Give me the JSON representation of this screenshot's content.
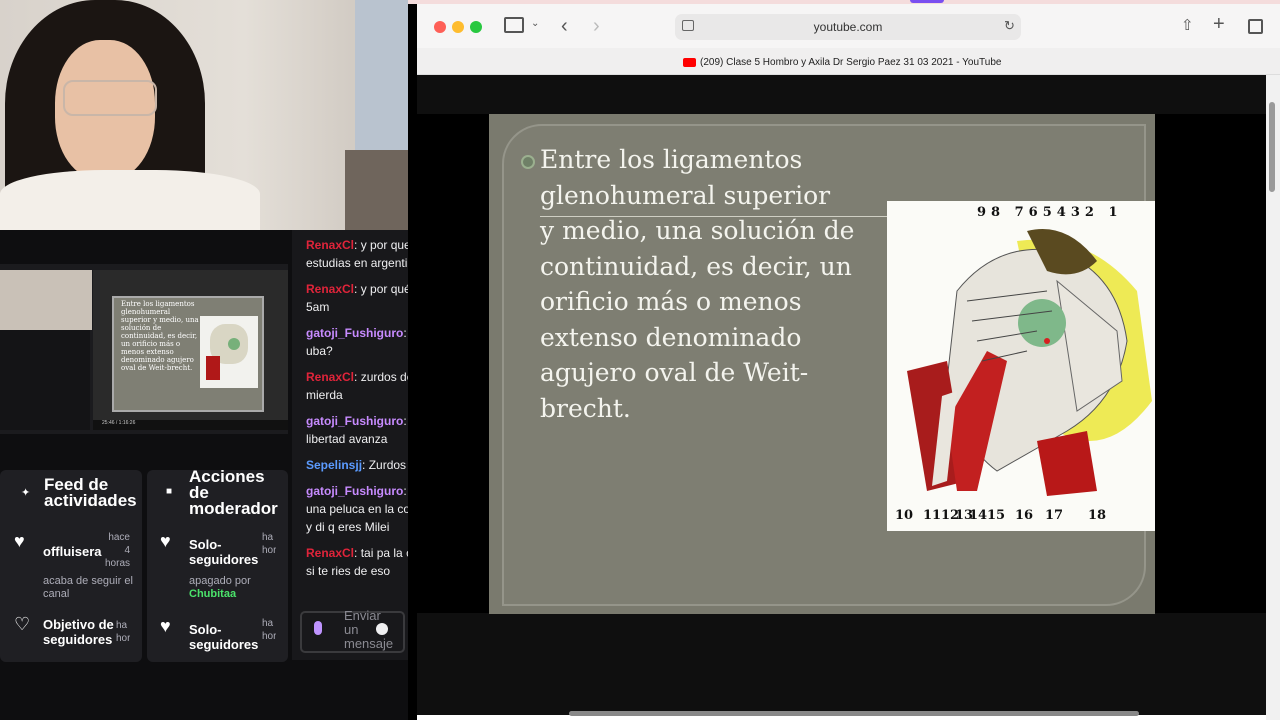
{
  "browser": {
    "url": "youtube.com",
    "tab_title": "(209) Clase 5 Hombro y Axila Dr Sergio Paez 31 03 2021 - YouTube"
  },
  "slide": {
    "lines": [
      "Entre los ligamentos",
      "glenohumeral superior",
      "y medio, una solución de",
      "continuidad, es decir, un",
      "orificio más o menos",
      "extenso denominado",
      "agujero oval de Weit-",
      "brecht."
    ],
    "top_numbers": [
      "9",
      "8",
      "7",
      "6",
      "5",
      "4",
      "3",
      "2",
      "1"
    ],
    "bottom_numbers": [
      "10",
      "11",
      "12",
      "13",
      "14",
      "15",
      "16",
      "17",
      "18"
    ]
  },
  "preview": {
    "slide_text": "Entre los ligamentos glenohumeral superior y medio, una solución de continuidad, es decir, un orificio más o menos extenso denominado agujero oval de Weit-brecht.",
    "time": "25:46 / 1:16:26"
  },
  "panels": {
    "feed": {
      "title": "Feed de actividades",
      "items": [
        {
          "name": "offluisera",
          "desc": "acaba de seguir el canal",
          "time": "hace 4 horas"
        },
        {
          "name": "Objetivo de seguidores",
          "desc": "",
          "time": "ha hor"
        }
      ]
    },
    "mod": {
      "title": "Acciones de moderador",
      "items": [
        {
          "name": "Solo-seguidores",
          "desc": "apagado por",
          "user": "Chubitaa",
          "time": "ha hor"
        },
        {
          "name": "Solo-seguidores",
          "desc": "",
          "user": "",
          "time": "ha hor"
        }
      ]
    }
  },
  "chat": {
    "messages": [
      {
        "user": "RenaxCl",
        "color": "#e0243a",
        "text": ": y por que",
        "cont": "estudias en argentin"
      },
      {
        "user": "RenaxCl",
        "color": "#e0243a",
        "text": ": y por qué",
        "cont": "5am"
      },
      {
        "user": "gatoji_Fushiguro",
        "color": "#c78bff",
        "text": ": c",
        "cont": "uba?"
      },
      {
        "user": "RenaxCl",
        "color": "#e0243a",
        "text": ": zurdos de",
        "cont": "mierda"
      },
      {
        "user": "gatoji_Fushiguro",
        "color": "#c78bff",
        "text": ": l",
        "cont": "libertad avanza"
      },
      {
        "user": "Sepelinsjj",
        "color": "#5b9bff",
        "text": ": Zurdos c",
        "cont": ""
      },
      {
        "user": "gatoji_Fushiguro",
        "color": "#c78bff",
        "text": ": p",
        "cont": "una peluca en la co"
      },
      {
        "user": "",
        "color": "#efeff1",
        "text": "",
        "cont": "y di q eres Milei"
      },
      {
        "user": "RenaxCl",
        "color": "#e0243a",
        "text": ": tai pa la c",
        "cont": "si te ries de eso"
      }
    ],
    "input_placeholder": "Enviar un mensaje"
  }
}
